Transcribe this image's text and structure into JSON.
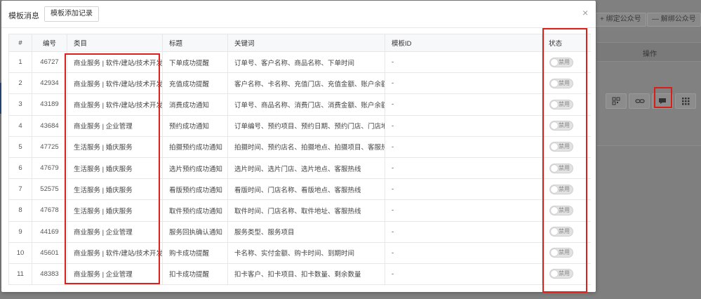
{
  "background": {
    "bind_btn_label": "+ 绑定公众号",
    "unbind_btn_label": "— 解绑公众号",
    "operations_header": "操作",
    "op_icons": [
      "qrcode-icon",
      "link-icon",
      "message-icon",
      "grid-icon"
    ]
  },
  "modal": {
    "title": "模板消息",
    "add_btn": "模板添加记录",
    "close": "×"
  },
  "table": {
    "headers": [
      "#",
      "编号",
      "类目",
      "标题",
      "关键词",
      "模板ID",
      "状态"
    ],
    "rows": [
      {
        "idx": "1",
        "code": "46727",
        "category": "商业服务 | 软件/建站/技术开发",
        "title": "下单成功提醒",
        "keywords": "订单号、客户名称、商品名称、下单时间",
        "tid": "-",
        "status": "禁用"
      },
      {
        "idx": "2",
        "code": "42934",
        "category": "商业服务 | 软件/建站/技术开发",
        "title": "充值成功提醒",
        "keywords": "客户名称、卡名称、充值门店、充值金额、账户余额",
        "tid": "-",
        "status": "禁用"
      },
      {
        "idx": "3",
        "code": "43189",
        "category": "商业服务 | 软件/建站/技术开发",
        "title": "消费成功通知",
        "keywords": "订单号、商品名称、消费门店、消费金额、账户余额",
        "tid": "-",
        "status": "禁用"
      },
      {
        "idx": "4",
        "code": "43684",
        "category": "商业服务 | 企业管理",
        "title": "预约成功通知",
        "keywords": "订单编号、预约项目、预约日期、预约门店、门店地址",
        "tid": "-",
        "status": "禁用"
      },
      {
        "idx": "5",
        "code": "47725",
        "category": "生活服务 | 婚庆服务",
        "title": "拍摄预约成功通知",
        "keywords": "拍摄时间、预约店名、拍摄地点、拍摄项目、客服热线",
        "tid": "-",
        "status": "禁用"
      },
      {
        "idx": "6",
        "code": "47679",
        "category": "生活服务 | 婚庆服务",
        "title": "选片预约成功通知",
        "keywords": "选片时间、选片门店、选片地点、客服热线",
        "tid": "-",
        "status": "禁用"
      },
      {
        "idx": "7",
        "code": "52575",
        "category": "生活服务 | 婚庆服务",
        "title": "看版预约成功通知",
        "keywords": "看版时间、门店名称、看版地点、客服热线",
        "tid": "-",
        "status": "禁用"
      },
      {
        "idx": "8",
        "code": "47678",
        "category": "生活服务 | 婚庆服务",
        "title": "取件预约成功通知",
        "keywords": "取件时间、门店名称、取件地址、客服热线",
        "tid": "-",
        "status": "禁用"
      },
      {
        "idx": "9",
        "code": "44169",
        "category": "商业服务 | 企业管理",
        "title": "服务回执确认通知",
        "keywords": "服务类型、服务项目",
        "tid": "-",
        "status": "禁用"
      },
      {
        "idx": "10",
        "code": "45601",
        "category": "商业服务 | 软件/建站/技术开发",
        "title": "购卡成功提醒",
        "keywords": "卡名称、实付金额、购卡时间、到期时间",
        "tid": "-",
        "status": "禁用"
      },
      {
        "idx": "11",
        "code": "48383",
        "category": "商业服务 | 企业管理",
        "title": "扣卡成功提醒",
        "keywords": "扣卡客户、扣卡项目、扣卡数量、剩余数量",
        "tid": "-",
        "status": "禁用"
      }
    ]
  },
  "colors": {
    "annotation": "#d9221c",
    "overlay": "#7f7f7f"
  }
}
